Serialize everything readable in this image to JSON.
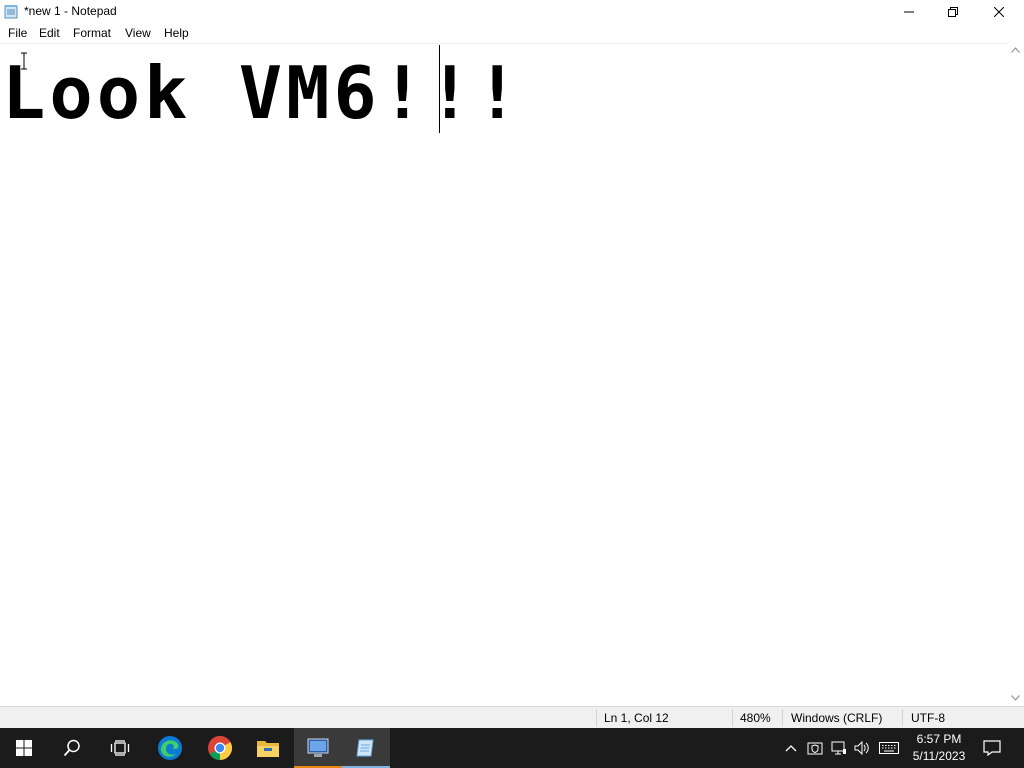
{
  "window": {
    "title": "*new 1 - Notepad",
    "icon": "notepad-icon",
    "controls": [
      "minimize-icon",
      "restore-icon",
      "close-icon"
    ]
  },
  "menu": {
    "items": [
      "File",
      "Edit",
      "Format",
      "View",
      "Help"
    ]
  },
  "editor": {
    "content": "Look VM6!!!"
  },
  "status": {
    "position": "Ln 1, Col 12",
    "zoom": "480%",
    "line_ending": "Windows (CRLF)",
    "encoding": "UTF-8"
  },
  "taskbar": {
    "apps": [
      "start-icon",
      "search-icon",
      "task-view-icon",
      "edge-icon",
      "chrome-icon",
      "file-explorer-icon",
      "remote-desktop-icon",
      "notepad-icon"
    ],
    "tray": [
      "chevron-up-icon",
      "security-icon",
      "network-icon",
      "volume-icon",
      "keyboard-icon"
    ],
    "time": "6:57 PM",
    "date": "5/11/2023",
    "notification_icon": "notification-icon",
    "colors": {
      "taskbar_bg": "#1b1b1b",
      "active_underline": "#7fb3e0",
      "active_orange": "#e8860f"
    }
  }
}
